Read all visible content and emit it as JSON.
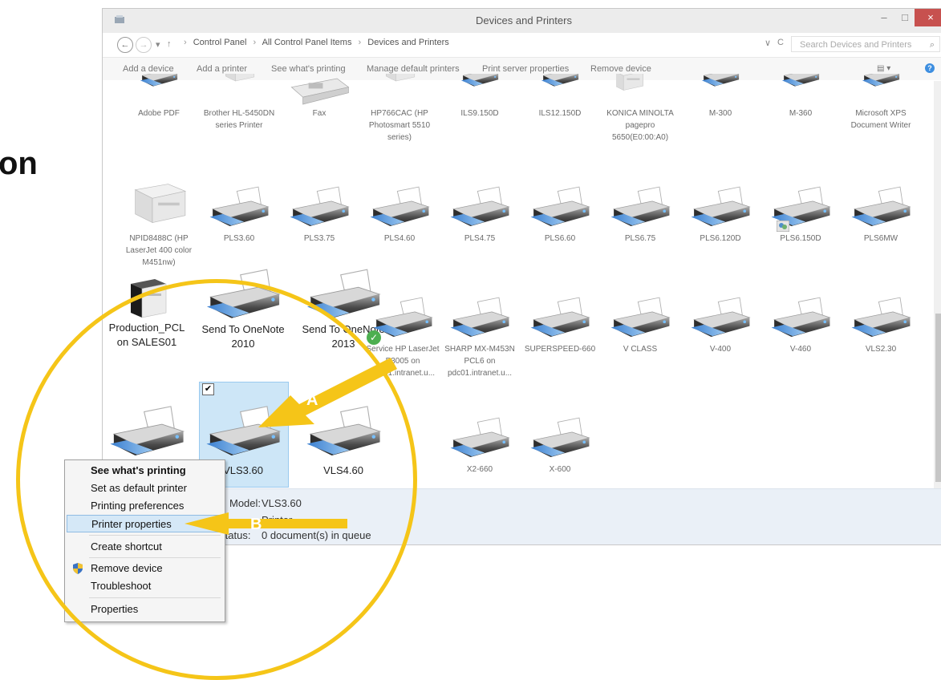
{
  "heading_fragment": "on",
  "window": {
    "title": "Devices and Printers",
    "minimize": "–",
    "maximize": "□",
    "close": "×"
  },
  "nav": {
    "back": "←",
    "forward": "→",
    "dropdown": "▾",
    "up": "↑"
  },
  "breadcrumb": [
    "Control Panel",
    "All Control Panel Items",
    "Devices and Printers"
  ],
  "breadcrumb_sep": "›",
  "address_controls": {
    "dropdown": "∨",
    "refresh": "C"
  },
  "search": {
    "placeholder": "Search Devices and Printers",
    "icon": "⌕"
  },
  "commands": [
    "Add a device",
    "Add a printer",
    "See what's printing",
    "Manage default printers",
    "Print server properties",
    "Remove device"
  ],
  "view_icon": "▤ ▾",
  "help_icon": "?",
  "row1": [
    "Adobe PDF",
    "Brother HL-5450DN series Printer",
    "Fax",
    "HP766CAC (HP Photosmart 5510 series)",
    "ILS9.150D",
    "ILS12.150D",
    "KONICA MINOLTA pagepro 5650(E0:00:A0)",
    "M-300",
    "M-360",
    "Microsoft XPS Document Writer"
  ],
  "row2": [
    "NPID8488C (HP LaserJet 400 color M451nw)",
    "PLS3.60",
    "PLS3.75",
    "PLS4.60",
    "PLS4.75",
    "PLS6.60",
    "PLS6.75",
    "PLS6.120D",
    "PLS6.150D",
    "PLS6MW"
  ],
  "row3": [
    "Production_PCL on SALES01",
    "Send To OneNote 2010",
    "Send To OneNote 2013",
    "Service HP LaserJet P3005 on pdc01.intranet.u...",
    "SHARP MX-M453N PCL6 on pdc01.intranet.u...",
    "SUPERSPEED-660",
    "V CLASS",
    "V-400",
    "V-460",
    "VLS2.30"
  ],
  "row4": [
    "",
    "VLS3.60",
    "VLS4.60",
    "X2-660",
    "X-600"
  ],
  "selected_check": "✔",
  "default_check": "✓",
  "details": {
    "model_label": "Model:",
    "model_value": "VLS3.60",
    "category_partial": "Printer",
    "status_label": "Status:",
    "status_value": "0 document(s) in queue"
  },
  "context_menu": [
    "See what's printing",
    "Set as default printer",
    "Printing preferences",
    "Printer properties",
    "Create shortcut",
    "Remove device",
    "Troubleshoot",
    "Properties"
  ],
  "callouts": {
    "a": "A",
    "b": "B"
  },
  "colors": {
    "callout": "#f5c518",
    "selection": "#cde6f7",
    "menu_highlight": "#d5e8f7",
    "close_button": "#c7514f"
  }
}
